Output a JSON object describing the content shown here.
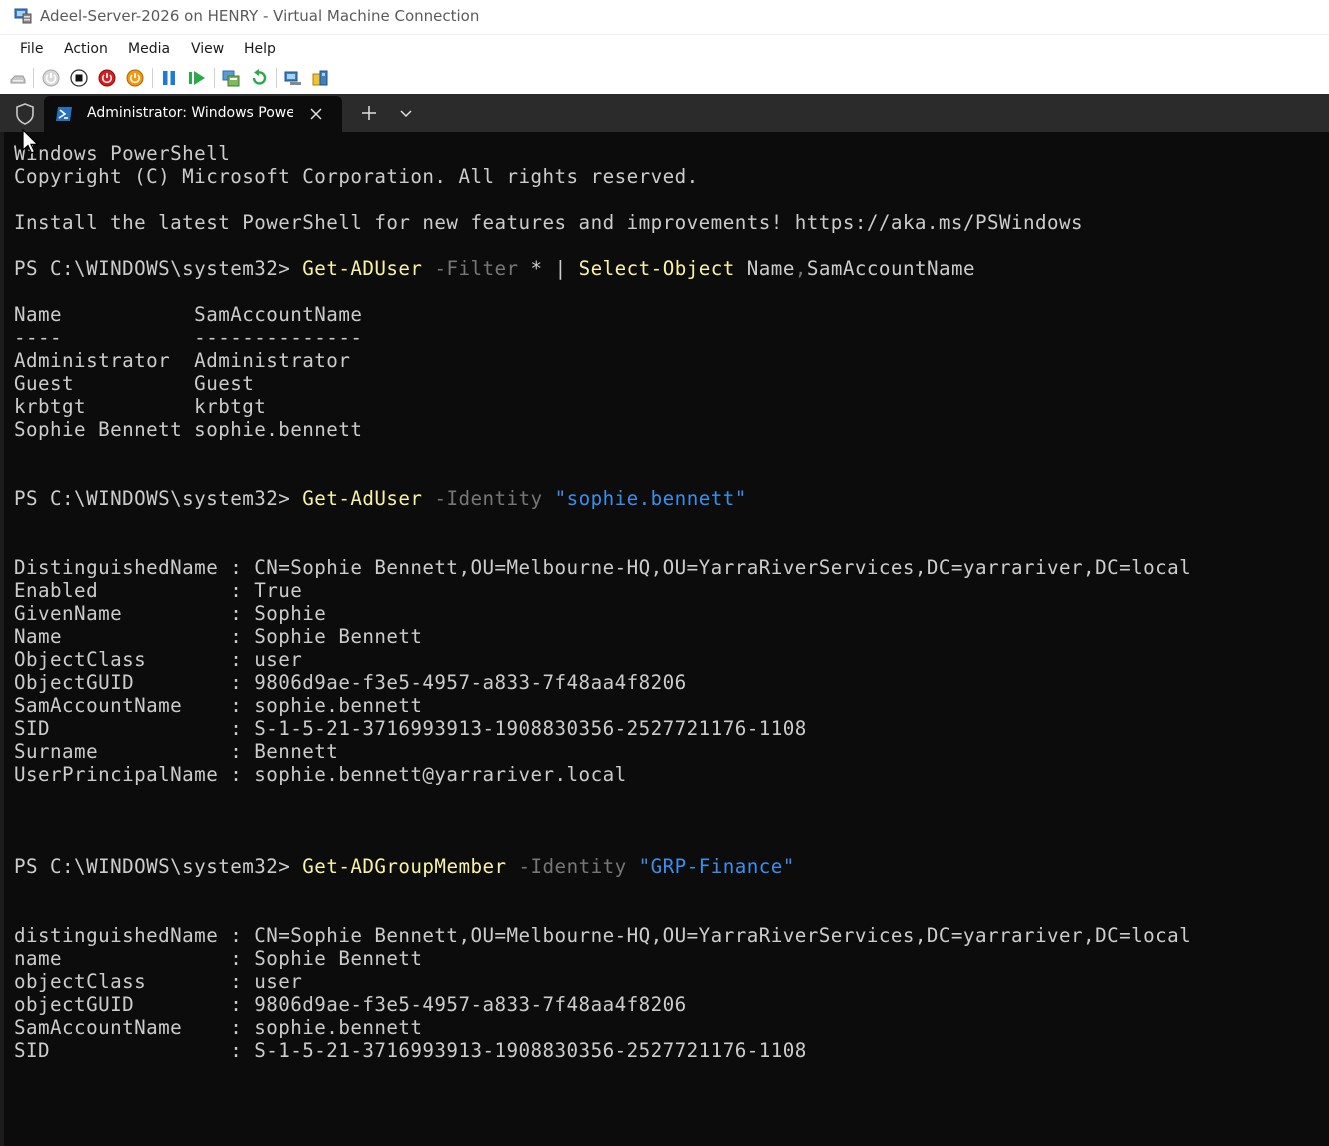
{
  "window": {
    "title": "Adeel-Server-2026 on HENRY - Virtual Machine Connection"
  },
  "menu": [
    "File",
    "Action",
    "Media",
    "View",
    "Help"
  ],
  "toolbar": {
    "icons": [
      "ctrl-alt-del-icon",
      "start-icon",
      "turn-off-icon",
      "shut-down-icon",
      "save-icon",
      "pause-icon",
      "resume-icon",
      "checkpoint-icon",
      "revert-icon",
      "enhanced-session-icon",
      "share-icon"
    ]
  },
  "tab": {
    "title": "Administrator: Windows PowerShell"
  },
  "terminal": {
    "banner1": "Windows PowerShell",
    "banner2": "Copyright (C) Microsoft Corporation. All rights reserved.",
    "banner3": "Install the latest PowerShell for new features and improvements! https://aka.ms/PSWindows",
    "prompt": "PS C:\\WINDOWS\\system32> ",
    "cmd1": {
      "cmdlet": "Get-ADUser",
      "param": "-Filter",
      "arg": "*",
      "pipe": "|",
      "cmdlet2": "Select-Object",
      "args2": "Name",
      "comma": ",",
      "args3": "SamAccountName"
    },
    "table": {
      "header": "Name           SamAccountName",
      "divider": "----           --------------",
      "rows": [
        "Administrator  Administrator",
        "Guest          Guest",
        "krbtgt         krbtgt",
        "Sophie Bennett sophie.bennett"
      ]
    },
    "cmd2": {
      "cmdlet": "Get-AdUser",
      "param": "-Identity",
      "arg": "\"sophie.bennett\""
    },
    "user_props": [
      "DistinguishedName : CN=Sophie Bennett,OU=Melbourne-HQ,OU=YarraRiverServices,DC=yarrariver,DC=local",
      "Enabled           : True",
      "GivenName         : Sophie",
      "Name              : Sophie Bennett",
      "ObjectClass       : user",
      "ObjectGUID        : 9806d9ae-f3e5-4957-a833-7f48aa4f8206",
      "SamAccountName    : sophie.bennett",
      "SID               : S-1-5-21-3716993913-1908830356-2527721176-1108",
      "Surname           : Bennett",
      "UserPrincipalName : sophie.bennett@yarrariver.local"
    ],
    "cmd3": {
      "cmdlet": "Get-ADGroupMember",
      "param": "-Identity",
      "arg": "\"GRP-Finance\""
    },
    "member_props": [
      "distinguishedName : CN=Sophie Bennett,OU=Melbourne-HQ,OU=YarraRiverServices,DC=yarrariver,DC=local",
      "name              : Sophie Bennett",
      "objectClass       : user",
      "objectGUID        : 9806d9ae-f3e5-4957-a833-7f48aa4f8206",
      "SamAccountName    : sophie.bennett",
      "SID               : S-1-5-21-3716993913-1908830356-2527721176-1108"
    ]
  },
  "colors": {
    "terminal_bg": "#0c0c0c",
    "terminal_fg": "#cccccc",
    "cmdlet": "#f9f1a5",
    "parameter": "#767676",
    "string": "#3b8eea",
    "tabstrip_bg": "#2b2b2b"
  }
}
